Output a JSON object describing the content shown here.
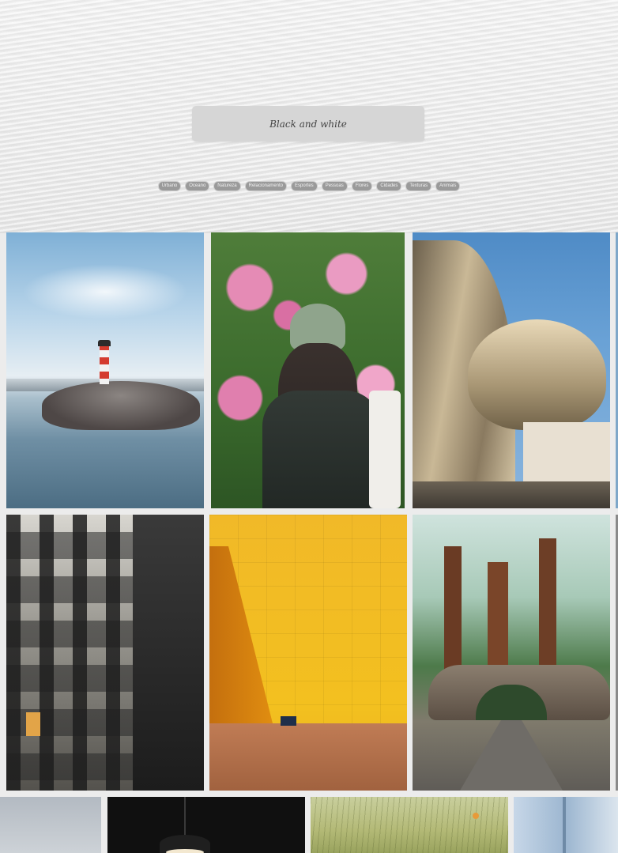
{
  "search": {
    "value": "Black and white"
  },
  "tags": [
    "Urbano",
    "Oceano",
    "Natureza",
    "Relacionamento",
    "Esportes",
    "Pessoas",
    "Flores",
    "Cidades",
    "Texturas",
    "Animais"
  ],
  "photos": [
    {
      "name": "photo-lighthouse"
    },
    {
      "name": "photo-woman-flowers"
    },
    {
      "name": "photo-curved-building"
    },
    {
      "name": "photo-fire-escape-building"
    },
    {
      "name": "photo-yellow-wall"
    },
    {
      "name": "photo-sequoia-tunnel"
    },
    {
      "name": "photo-cloudy-sky"
    },
    {
      "name": "photo-pendant-lamp"
    },
    {
      "name": "photo-grass-field"
    },
    {
      "name": "photo-blue-blur"
    }
  ]
}
